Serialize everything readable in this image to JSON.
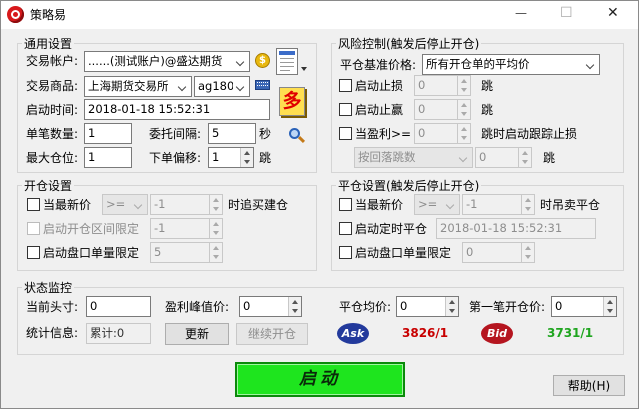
{
  "window": {
    "title": "策略易",
    "minimize_glyph": "—",
    "maximize_glyph": "☐",
    "close_glyph": "✕"
  },
  "general": {
    "title": "通用设置",
    "account_label": "交易帐户:",
    "account_value": "......(测试账户)@盛达期货",
    "product_label": "交易商品:",
    "exchange_value": "上海期货交易所",
    "contract_value": "ag1802",
    "start_time_label": "启动时间:",
    "start_time_value": "2018-01-18 15:52:31",
    "single_qty_label": "单笔数量:",
    "single_qty_value": "1",
    "order_interval_label": "委托间隔:",
    "order_interval_value": "5",
    "order_interval_unit": "秒",
    "max_position_label": "最大仓位:",
    "max_position_value": "1",
    "order_offset_label": "下单偏移:",
    "order_offset_value": "1",
    "order_offset_unit": "跳",
    "direction_label": "多"
  },
  "risk": {
    "title": "风险控制(触发后停止开仓)",
    "base_price_label": "平仓基准价格:",
    "base_price_value": "所有开仓单的平均价",
    "stop_loss_label": "启动止损",
    "stop_loss_value": "0",
    "stop_loss_unit": "跳",
    "take_profit_label": "启动止赢",
    "take_profit_value": "0",
    "take_profit_unit": "跳",
    "trailing_label": "当盈利>=",
    "trailing_value": "0",
    "trailing_suffix": "跳时启动跟踪止损",
    "pullback_mode": "按回落跳数",
    "pullback_value": "0",
    "pullback_unit": "跳"
  },
  "open": {
    "title": "开仓设置",
    "latest_price_label": "当最新价",
    "operator": ">=",
    "price_value": "-1",
    "action_label": "时追买建仓",
    "range_limit_label": "启动开仓区间限定",
    "range_limit_value": "-1",
    "single_limit_label": "启动盘口单量限定",
    "single_limit_value": "5"
  },
  "close": {
    "title": "平仓设置(触发后停止开仓)",
    "latest_price_label": "当最新价",
    "operator": ">=",
    "price_value": "-1",
    "action_label": "时吊卖平仓",
    "timed_label": "启动定时平仓",
    "timed_value": "2018-01-18 15:52:31",
    "single_limit_label": "启动盘口单量限定",
    "single_limit_value": "0"
  },
  "status": {
    "title": "状态监控",
    "position_label": "当前头寸:",
    "position_value": "0",
    "peak_label": "盈利峰值价:",
    "peak_value": "0",
    "close_avg_label": "平仓均价:",
    "close_avg_value": "0",
    "first_open_label": "第一笔开仓价:",
    "first_open_value": "0",
    "stats_label": "统计信息:",
    "stats_value": "累计:0",
    "refresh_button": "更新",
    "continue_button": "继续开仓",
    "ask_label": "Ask",
    "ask_value": "3826/1",
    "bid_label": "Bid",
    "bid_value": "3731/1"
  },
  "footer": {
    "start_button": "启动",
    "help_button": "帮助(H)"
  },
  "colors": {
    "ask_value": "#c80000",
    "bid_value": "#1fa51f",
    "start_button": "#1ee51e",
    "direction_bg": "#ffdf50",
    "direction_text": "#e00000"
  }
}
